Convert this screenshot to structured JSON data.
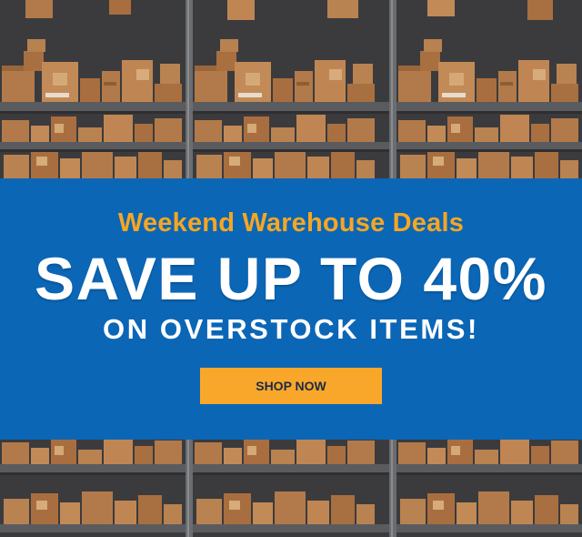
{
  "promo": {
    "subtitle": "Weekend Warehouse Deals",
    "headline": "SAVE UP TO 40%",
    "tagline": "ON OVERSTOCK ITEMS!",
    "cta_label": "SHOP NOW"
  },
  "colors": {
    "panel_blue": "#0b66b6",
    "accent_orange": "#f5a623",
    "button_orange": "#f9a72b",
    "shelf_gray": "#5a5b5e",
    "box_brown": "#b27a4a",
    "wall_dark": "#3b3b3d"
  }
}
